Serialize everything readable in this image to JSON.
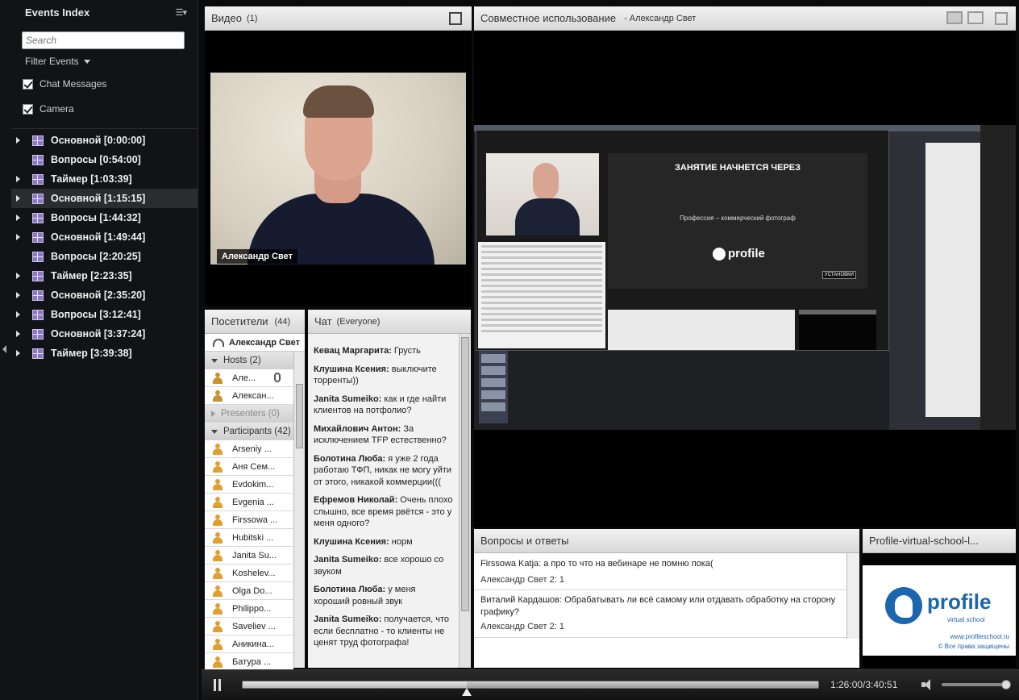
{
  "events": {
    "title": "Events Index",
    "search_placeholder": "Search",
    "filter_label": "Filter Events",
    "checks": [
      "Chat Messages",
      "Camera"
    ],
    "items": [
      {
        "label": "Основной [0:00:00]",
        "expandable": true
      },
      {
        "label": "Вопросы [0:54:00]",
        "expandable": false
      },
      {
        "label": "Таймер [1:03:39]",
        "expandable": true
      },
      {
        "label": "Основной [1:15:15]",
        "expandable": true,
        "selected": true
      },
      {
        "label": "Вопросы [1:44:32]",
        "expandable": true
      },
      {
        "label": "Основной [1:49:44]",
        "expandable": true
      },
      {
        "label": "Вопросы [2:20:25]",
        "expandable": false
      },
      {
        "label": "Таймер [2:23:35]",
        "expandable": true
      },
      {
        "label": "Основной [2:35:20]",
        "expandable": true
      },
      {
        "label": "Вопросы [3:12:41]",
        "expandable": true
      },
      {
        "label": "Основной [3:37:24]",
        "expandable": true
      },
      {
        "label": "Таймер [3:39:38]",
        "expandable": true
      }
    ]
  },
  "video": {
    "title": "Видео",
    "count": "(1)",
    "name": "Александр Свет"
  },
  "share": {
    "title": "Совместное использование",
    "presenter": "- Александр Свет",
    "slide_title": "ЗАНЯТИЕ НАЧНЕТСЯ ЧЕРЕЗ",
    "slide_subtitle": "Профессия – коммерческий фотограф",
    "slide_logo": "profile",
    "slide_button": "УСТАНОВКИ"
  },
  "attendees": {
    "title": "Посетители",
    "count": "(44)",
    "self_name": "Александр Свет",
    "hosts_label": "Hosts (2)",
    "hosts": [
      "Але...",
      "Алексан..."
    ],
    "presenters_label": "Presenters (0)",
    "participants_label": "Participants (42)",
    "participants": [
      "Arseniy ...",
      "Аня Сем...",
      "Evdokim...",
      "Evgenia ...",
      "Firssowa ...",
      "Hubitski ...",
      "Janita Su...",
      "Koshelev...",
      "Olga Do...",
      "Philippo...",
      "Saveliev ...",
      "Аникина...",
      "Батура ..."
    ]
  },
  "chat": {
    "title": "Чат",
    "scope": "(Everyone)",
    "messages": [
      {
        "author": "Кевац Маргарита:",
        "text": " Грусть"
      },
      {
        "author": "Клушина Ксения:",
        "text": " выключите торренты))"
      },
      {
        "author": "Janita Sumeiko:",
        "text": " как и где найти клиентов на потфолио?"
      },
      {
        "author": "Михайлович Антон:",
        "text": " За исключением TFP естественно?"
      },
      {
        "author": "Болотина Люба:",
        "text": " я уже 2 года работаю ТФП, никак не могу уйти от этого, никакой коммерции((("
      },
      {
        "author": "Ефремов Николай:",
        "text": " Очень плохо слышно, все время рвётся - это у меня одного?"
      },
      {
        "author": "Клушина Ксения:",
        "text": " норм"
      },
      {
        "author": "Janita Sumeiko:",
        "text": " все хорошо со звуком"
      },
      {
        "author": "Болотина Люба:",
        "text": " у меня хороший ровный звук"
      },
      {
        "author": "Janita Sumeiko:",
        "text": " получается, что если бесплатно - то клиенты не ценят труд фотографа!"
      }
    ]
  },
  "qa": {
    "title": "Вопросы и ответы",
    "items": [
      {
        "question": "Firssowa Katja: а про то что на вебинаре не помню пока(",
        "answer": "Александр Свет 2: 1"
      },
      {
        "question": "Виталий Кардашов: Обрабатывать ли всё самому или отдавать обработку на сторону графику?",
        "answer": "Александр Свет 2: 1"
      }
    ]
  },
  "logo_pod": {
    "title": "Profile-virtual-school-l...",
    "word": "profile",
    "tagline": "virtual school",
    "url": "www.profileschool.ru",
    "rights": "© Все права защищены"
  },
  "playback": {
    "time": "1:26:00/3:40:51",
    "progress": 0.3894,
    "volume": 0.95
  }
}
